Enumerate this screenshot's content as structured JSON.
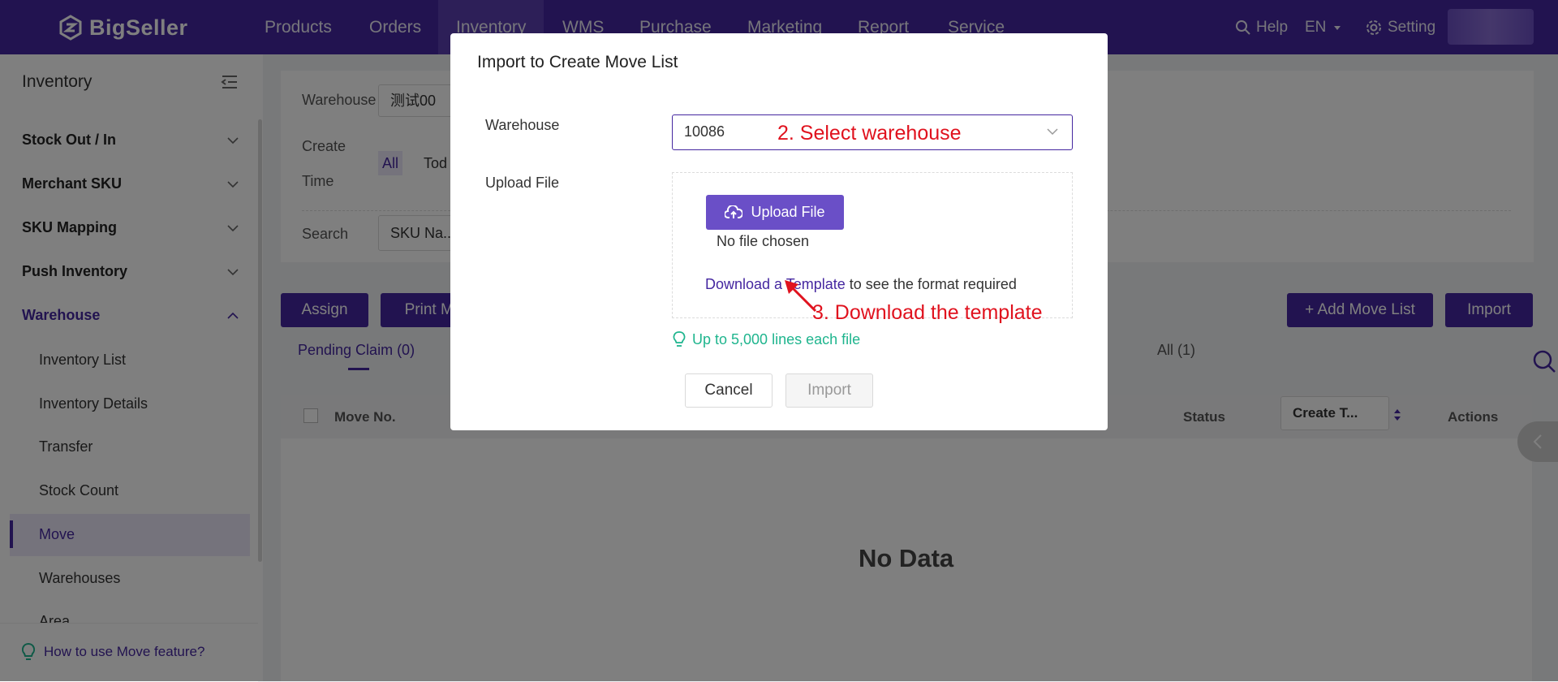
{
  "brand": {
    "name": "BigSeller"
  },
  "nav": {
    "items": [
      "Products",
      "Orders",
      "Inventory",
      "WMS",
      "Purchase",
      "Marketing",
      "Report",
      "Service"
    ],
    "active": "Inventory",
    "help": "Help",
    "language": "EN",
    "setting": "Setting"
  },
  "sidebar": {
    "title": "Inventory",
    "groups": [
      "Stock Out / In",
      "Merchant SKU",
      "SKU Mapping",
      "Push Inventory",
      "Warehouse"
    ],
    "items": [
      "Inventory List",
      "Inventory Details",
      "Transfer",
      "Stock Count",
      "Move",
      "Warehouses",
      "Area"
    ],
    "active_item": "Move",
    "help_link": "How to use Move feature?"
  },
  "filters": {
    "warehouse_label": "Warehouse",
    "warehouse_value": "测试00",
    "create_time_label_1": "Create",
    "create_time_label_2": "Time",
    "time_all": "All",
    "time_today": "Tod",
    "search_label": "Search",
    "search_field": "SKU Na..."
  },
  "toolbar": {
    "assign": "Assign",
    "print": "Print Mo",
    "add_move_list": "+ Add Move List",
    "import": "Import"
  },
  "tabs": {
    "pending": "Pending Claim (0)",
    "hidden_count": ")",
    "all": "All (1)"
  },
  "table": {
    "columns": [
      "Move No.",
      "Status",
      "Create T...",
      "Actions"
    ],
    "empty": "No Data"
  },
  "modal": {
    "title": "Import to Create Move List",
    "warehouse_label": "Warehouse",
    "warehouse_value": "10086",
    "upload_label": "Upload File",
    "upload_button": "Upload File",
    "no_file": "No file chosen",
    "template_link": "Download a Template",
    "template_suffix": " to see the format required",
    "hint": "Up to 5,000 lines each file",
    "cancel": "Cancel",
    "import": "Import"
  },
  "annotations": {
    "step2": "2. Select warehouse",
    "step3": "3. Download the template"
  },
  "colors": {
    "primary": "#4527a0",
    "upload_button": "#6a4fc7",
    "hint_green": "#1fb58e",
    "annotation_red": "#e0121e"
  }
}
